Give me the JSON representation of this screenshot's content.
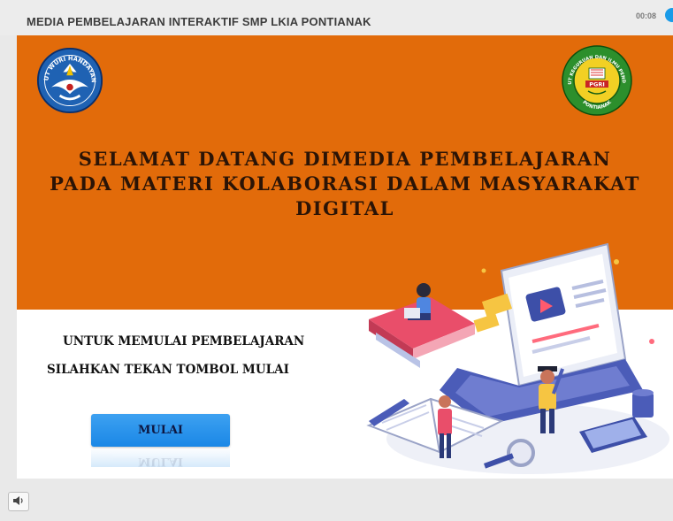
{
  "header": {
    "title": "MEDIA PEMBELAJARAN INTERAKTIF SMP LKIA PONTIANAK",
    "timer": "00:08"
  },
  "banner": {
    "welcome_lines": [
      "SELAMAT DATANG DIMEDIA PEMBELAJARAN",
      "PADA MATERI KOLABORASI DALAM MASYARAKAT",
      "DIGITAL"
    ],
    "logo_left": {
      "text": "TUT WURI HANDAYANI",
      "icon": "tut-wuri-handayani-logo"
    },
    "logo_right": {
      "text": "INSTITUT KEGURUAN DAN ILMU PENDIDIKAN",
      "badge": "PGRI",
      "city": "PONTIANAK",
      "icon": "ikip-pgri-logo"
    }
  },
  "instructions": {
    "line1": "UNTUK MEMULAI PEMBELAJARAN",
    "line2": "SILAHKAN TEKAN TOMBOL MULAI"
  },
  "start_button": {
    "label": "MULAI"
  },
  "player": {
    "audio_icon": "speaker-icon"
  },
  "colors": {
    "banner": "#e26b0a",
    "button": "#1a87e6",
    "timer_dot": "#1a9be8",
    "title_text": "#3d3d3d"
  }
}
